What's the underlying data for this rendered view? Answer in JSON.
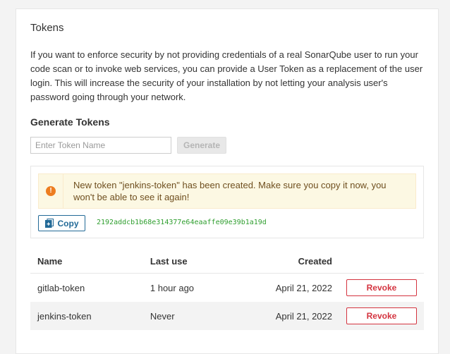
{
  "section": {
    "title": "Tokens",
    "description": "If you want to enforce security by not providing credentials of a real SonarQube user to run your code scan or to invoke web services, you can provide a User Token as a replacement of the user login. This will increase the security of your installation by not letting your analysis user's password going through your network."
  },
  "generate": {
    "heading": "Generate Tokens",
    "input_placeholder": "Enter Token Name",
    "input_value": "",
    "button_label": "Generate"
  },
  "new_token": {
    "alert_text": "New token \"jenkins-token\" has been created. Make sure you copy it now, you won't be able to see it again!",
    "alert_icon": "warning-icon",
    "copy_label": "Copy",
    "copy_icon": "copy-icon",
    "token_value": "2192addcb1b68e314377e64eaaffe09e39b1a19d"
  },
  "table": {
    "headers": {
      "name": "Name",
      "last_use": "Last use",
      "created": "Created"
    },
    "rows": [
      {
        "name": "gitlab-token",
        "last_use": "1 hour ago",
        "created": "April 21, 2022",
        "action": "Revoke"
      },
      {
        "name": "jenkins-token",
        "last_use": "Never",
        "created": "April 21, 2022",
        "action": "Revoke"
      }
    ]
  },
  "colors": {
    "accent": "#236a97",
    "danger": "#d4333f",
    "warning": "#ed7d20",
    "token_text": "#2e9e2e"
  }
}
